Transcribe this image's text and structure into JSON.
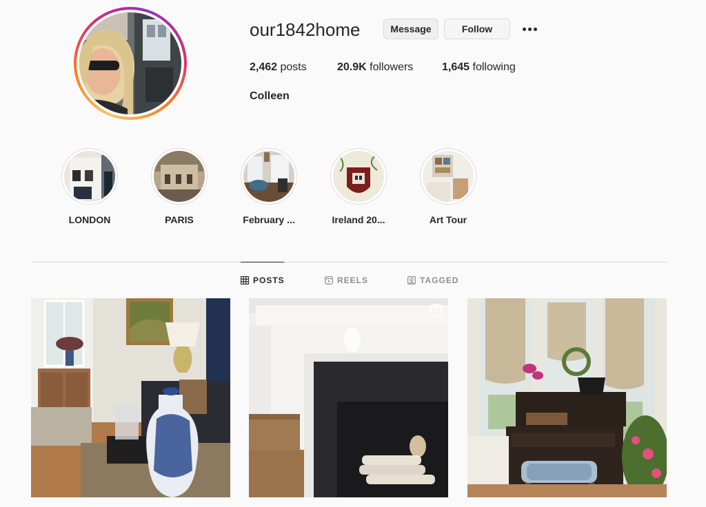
{
  "profile": {
    "username": "our1842home",
    "message_label": "Message",
    "follow_label": "Follow",
    "posts_count": "2,462",
    "posts_word": "posts",
    "followers_count": "20.9K",
    "followers_word": "followers",
    "following_count": "1,645",
    "following_word": "following",
    "full_name": "Colleen"
  },
  "highlights": [
    {
      "label": "LONDON"
    },
    {
      "label": "PARIS"
    },
    {
      "label": "February ..."
    },
    {
      "label": "Ireland 20..."
    },
    {
      "label": "Art Tour"
    }
  ],
  "tabs": [
    {
      "label": "POSTS",
      "icon": "grid-icon",
      "active": true
    },
    {
      "label": "REELS",
      "icon": "reels-icon",
      "active": false
    },
    {
      "label": "TAGGED",
      "icon": "tagged-icon",
      "active": false
    }
  ],
  "colors": {
    "story_ring": [
      "#fdc468",
      "#fa7e1e",
      "#d62976",
      "#962fbf"
    ],
    "text": "#262626",
    "muted": "#8e8e8e",
    "divider": "#dbdbdb"
  }
}
